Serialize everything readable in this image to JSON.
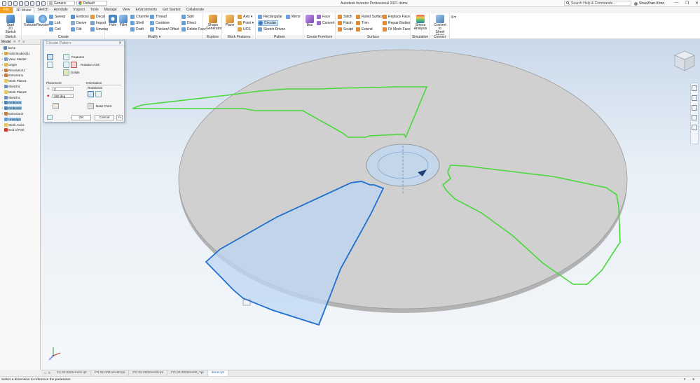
{
  "app": {
    "title": "Autodesk Inventor Professional 2021   dome",
    "search_placeholder": "Search Help & Commands...",
    "user": "ShaoZhan.Khoo",
    "material": "Generic",
    "appearance": "Default",
    "window_controls": [
      "—",
      "❐",
      "✕"
    ]
  },
  "tabs": [
    "File",
    "3D Model",
    "Sketch",
    "Annotate",
    "Inspect",
    "Tools",
    "Manage",
    "View",
    "Environments",
    "Get Started",
    "Collaborate"
  ],
  "active_tab": "3D Model",
  "ribbon": {
    "sketch": {
      "label": "Sketch",
      "start": "Start\n2D Sketch"
    },
    "create": {
      "label": "Create",
      "extrude": "Extrude",
      "revolve": "Revolve",
      "sweep": "Sweep",
      "emboss": "Emboss",
      "decal": "Decal",
      "loft": "Loft",
      "derive": "Derive",
      "import": "Import",
      "coil": "Coil",
      "rib": "Rib",
      "unwrap": "Unwrap"
    },
    "modify": {
      "label": "Modify ▾",
      "hole": "Hole",
      "fillet": "Fillet",
      "chamfer": "Chamfer",
      "thread": "Thread",
      "split": "Split",
      "shell": "Shell",
      "combine": "Combine",
      "direct": "Direct",
      "draft": "Draft",
      "thicken": "Thicken/ Offset",
      "delete_face": "Delete Face"
    },
    "explore": {
      "label": "Explore",
      "shape_generator": "Shape\nGenerator"
    },
    "work_features": {
      "label": "Work Features",
      "plane": "Plane",
      "axis": "Axis ▾",
      "point": "Point ▾",
      "ucs": "UCS"
    },
    "pattern": {
      "label": "Pattern",
      "rectangular": "Rectangular",
      "mirror": "Mirror",
      "circular": "Circular",
      "sketch_driven": "Sketch Driven"
    },
    "freeform": {
      "label": "Create Freeform",
      "box": "Box",
      "face": "Face",
      "convert": "Convert"
    },
    "surface": {
      "label": "Surface",
      "stitch": "Stitch",
      "ruled_surface": "Ruled Surface",
      "replace_face": "Replace Face",
      "patch": "Patch",
      "trim": "Trim",
      "repair_bodies": "Repair Bodies",
      "sculpt": "Sculpt",
      "extend": "Extend",
      "fit_mesh_face": "Fit Mesh Face"
    },
    "simulation": {
      "label": "Simulation",
      "stress": "Stress\nAnalysis"
    },
    "convert": {
      "label": "Convert",
      "sheet_metal": "Convert to\nSheet Metal"
    }
  },
  "browser": {
    "title": "Model",
    "items": [
      {
        "label": "dome",
        "expander": "",
        "icon_color": "#5b84b5"
      },
      {
        "label": "Solid Bodies(1)",
        "expander": "+",
        "icon_color": "#d7a84a"
      },
      {
        "label": "View: Master",
        "expander": "+",
        "icon_color": "#7a9cc4"
      },
      {
        "label": "Origin",
        "expander": "+",
        "icon_color": "#e0b84a"
      },
      {
        "label": "Revolution1",
        "expander": "+",
        "icon_color": "#c08040"
      },
      {
        "label": "Extrusion1",
        "expander": "+",
        "icon_color": "#c08040"
      },
      {
        "label": "Work Plane1",
        "expander": "",
        "icon_color": "#e6c85a"
      },
      {
        "label": "Sketch3",
        "expander": "",
        "icon_color": "#6c8fbd"
      },
      {
        "label": "Work Plane3",
        "expander": "",
        "icon_color": "#e6c85a"
      },
      {
        "label": "Sketch4",
        "expander": "",
        "icon_color": "#6c8fbd"
      },
      {
        "label": "Emboss1",
        "expander": "+",
        "icon_color": "#4f7fb8",
        "selected": true
      },
      {
        "label": "Emboss2",
        "expander": "+",
        "icon_color": "#4f7fb8",
        "selected": true
      },
      {
        "label": "Extrusion2",
        "expander": "+",
        "icon_color": "#c08040"
      },
      {
        "label": "Unwrap1",
        "expander": "",
        "icon_color": "#5c9bd6",
        "selected": true
      },
      {
        "label": "Work Axis1",
        "expander": "",
        "icon_color": "#e6c85a"
      },
      {
        "label": "End of Part",
        "expander": "",
        "icon_color": "#d23a2a"
      }
    ]
  },
  "dialog": {
    "title": "Circular Pattern",
    "features": "Features",
    "rotation_axis": "Rotation Axis",
    "solids": "Solids",
    "placement": "Placement",
    "orientation": "Orientation",
    "count": "3",
    "angle": "360 deg",
    "rotational": "Rotational",
    "base_point": "Base Point",
    "ok": "OK",
    "cancel": "Cancel",
    "more": ">>"
  },
  "doc_tabs": {
    "items": [
      "FA 02.0001rev01.ipt",
      "FO 02.0001rev00.ipt",
      "FO 02.0002rev00.ipt",
      "FO 02.0003rev00_1pt",
      "dome.ipt"
    ],
    "active_index": 4
  },
  "status": {
    "left": "Select a dimension to reference the parameter.",
    "right": [
      "1",
      "5"
    ]
  }
}
